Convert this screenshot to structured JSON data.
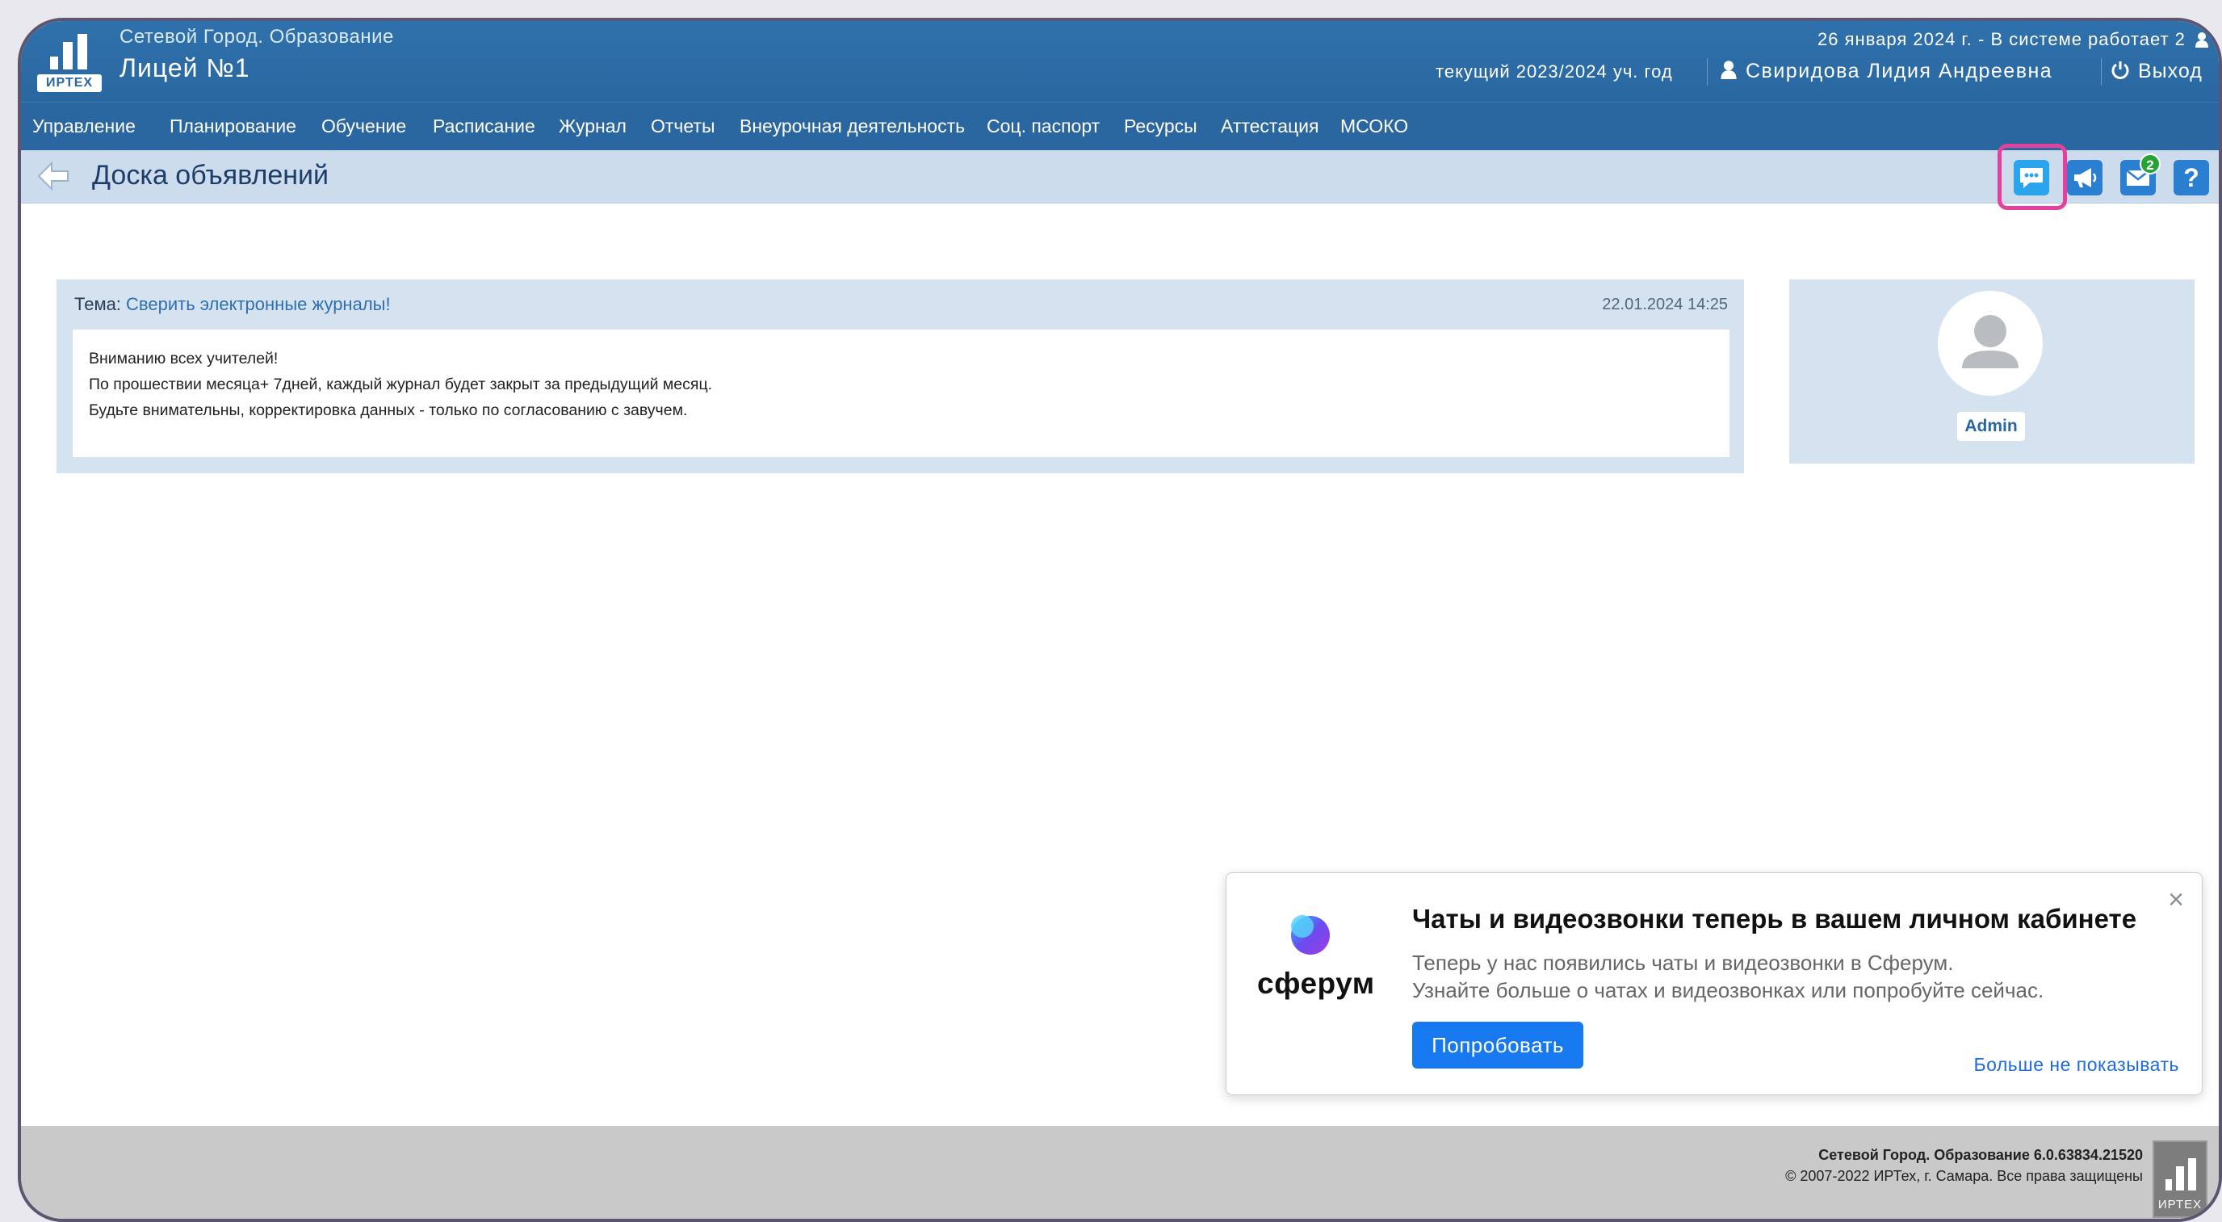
{
  "header": {
    "app_title": "Сетевой Город. Образование",
    "school_name": "Лицей №1",
    "logo_text": "ИРТЕХ",
    "date_line": "26 января 2024 г. - В системе работает 2",
    "school_year": "текущий 2023/2024 уч. год",
    "user_name": "Свиридова Лидия Андреевна",
    "logout_label": "Выход"
  },
  "nav": {
    "items": [
      "Управление",
      "Планирование",
      "Обучение",
      "Расписание",
      "Журнал",
      "Отчеты",
      "Внеурочная деятельность",
      "Соц. паспорт",
      "Ресурсы",
      "Аттестация",
      "МСОКО"
    ]
  },
  "toolbar": {
    "page_title": "Доска объявлений",
    "mail_badge": "2",
    "help_label": "?",
    "highlight_color": "#e5409b"
  },
  "post": {
    "topic_label": "Тема:",
    "topic": "Сверить электронные журналы!",
    "date": "22.01.2024 14:25",
    "lines": [
      "Вниманию всех учителей!",
      "По прошествии месяца+ 7дней, каждый журнал будет закрыт за предыдущий месяц.",
      "Будьте внимательны, корректировка данных - только по согласованию с завучем."
    ],
    "author": "Admin"
  },
  "popup": {
    "brand": "сферум",
    "title": "Чаты и видеозвонки теперь в вашем личном кабинете",
    "line1": "Теперь у нас появились чаты и видеозвонки в Сферум.",
    "line2": "Узнайте больше о чатах и видеозвонках или попробуйте сейчас.",
    "try_label": "Попробовать",
    "dismiss_label": "Больше не показывать",
    "close_label": "×"
  },
  "footer": {
    "version": "Сетевой Город. Образование 6.0.63834.21520",
    "copyright": "© 2007-2022 ИРТех, г. Самара. Все права защищены",
    "logo_text": "ИРТЕХ"
  }
}
